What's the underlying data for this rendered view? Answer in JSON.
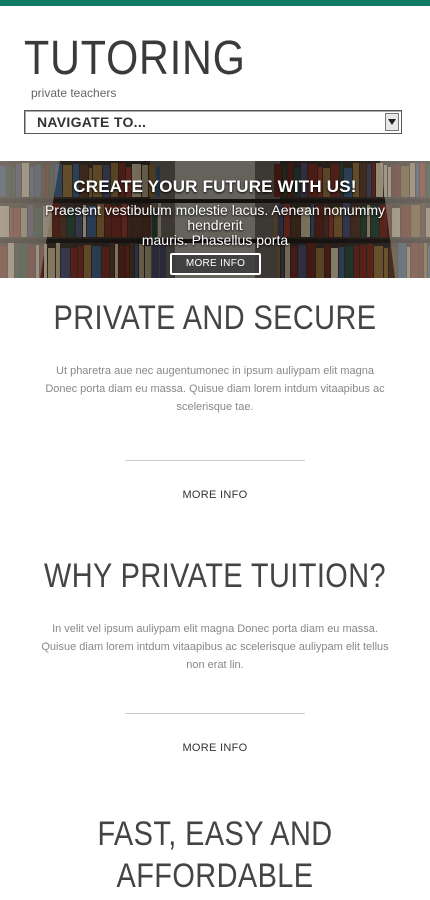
{
  "header": {
    "logo": "TUTORING",
    "tagline": "private teachers",
    "nav_select_value": "NAVIGATE TO..."
  },
  "hero": {
    "title": "CREATE YOUR FUTURE WITH US!",
    "text_line1": "Praesent vestibulum molestie lacus. Aenean nonummy hendrerit",
    "text_line2": "mauris. Phasellus porta",
    "button": "MORE INFO"
  },
  "sections": [
    {
      "title": "PRIVATE AND SECURE",
      "text": "Ut pharetra aue nec augentumonec in ipsum auliypam elit magna Donec porta diam eu massa. Quisue diam lorem intdum vitaapibus ac scelerisque tae.",
      "link": "MORE INFO"
    },
    {
      "title": "WHY PRIVATE TUITION?",
      "text": "In velit vel ipsum auliypam elit magna Donec porta diam eu massa. Quisue diam lorem intdum vitaapibus ac scelerisque auliypam elit tellus non erat lin.",
      "link": "MORE INFO"
    },
    {
      "title_line1": "FAST, EASY AND",
      "title_line2": "AFFORDABLE"
    }
  ],
  "colors": {
    "accent_bar": "#0f7a64"
  }
}
